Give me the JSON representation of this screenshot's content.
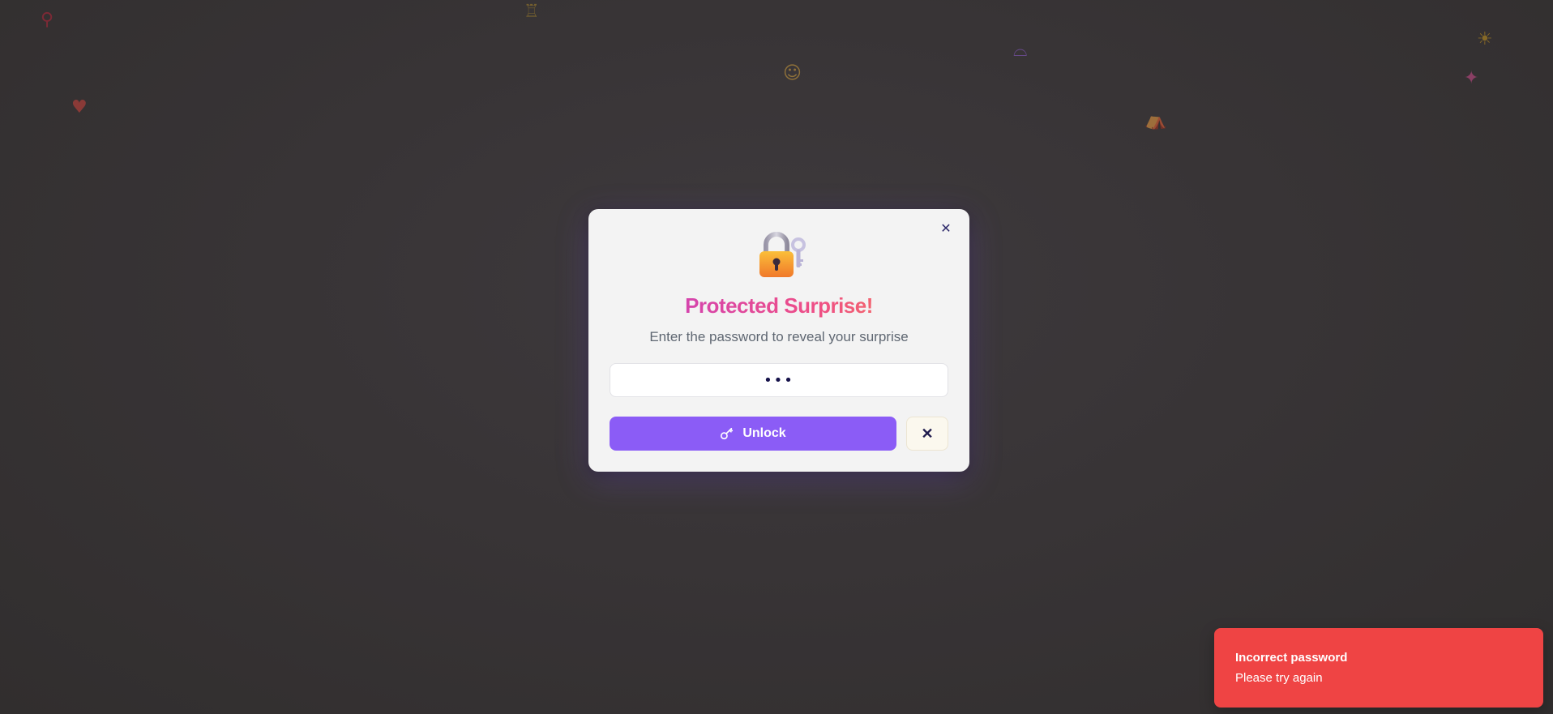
{
  "background_decor": [
    {
      "icon": "balloon-icon",
      "glyph": "⚲"
    },
    {
      "icon": "cake-icon",
      "glyph": "♖"
    },
    {
      "icon": "rainbow-icon",
      "glyph": "⌓"
    },
    {
      "icon": "sun-icon",
      "glyph": "☀"
    },
    {
      "icon": "theater-masks-icon",
      "glyph": "☺"
    },
    {
      "icon": "party-popper-icon",
      "glyph": "✦"
    },
    {
      "icon": "heart-icon",
      "glyph": "♥"
    },
    {
      "icon": "circus-tent-icon",
      "glyph": "⛺"
    }
  ],
  "modal": {
    "title": "Protected Surprise!",
    "subtitle": "Enter the password to reveal your surprise",
    "close_glyph": "✕",
    "lock_icon": "locked-with-key-icon",
    "password": {
      "value": "abc",
      "placeholder": ""
    },
    "unlock_label": "Unlock",
    "cancel_glyph": "✕"
  },
  "toast": {
    "title": "Incorrect password",
    "message": "Please try again",
    "color": "#ef4444"
  },
  "colors": {
    "accent": "#8b5cf6",
    "title_gradient": [
      "#c23cc9",
      "#ef4f86",
      "#f7854a"
    ]
  }
}
